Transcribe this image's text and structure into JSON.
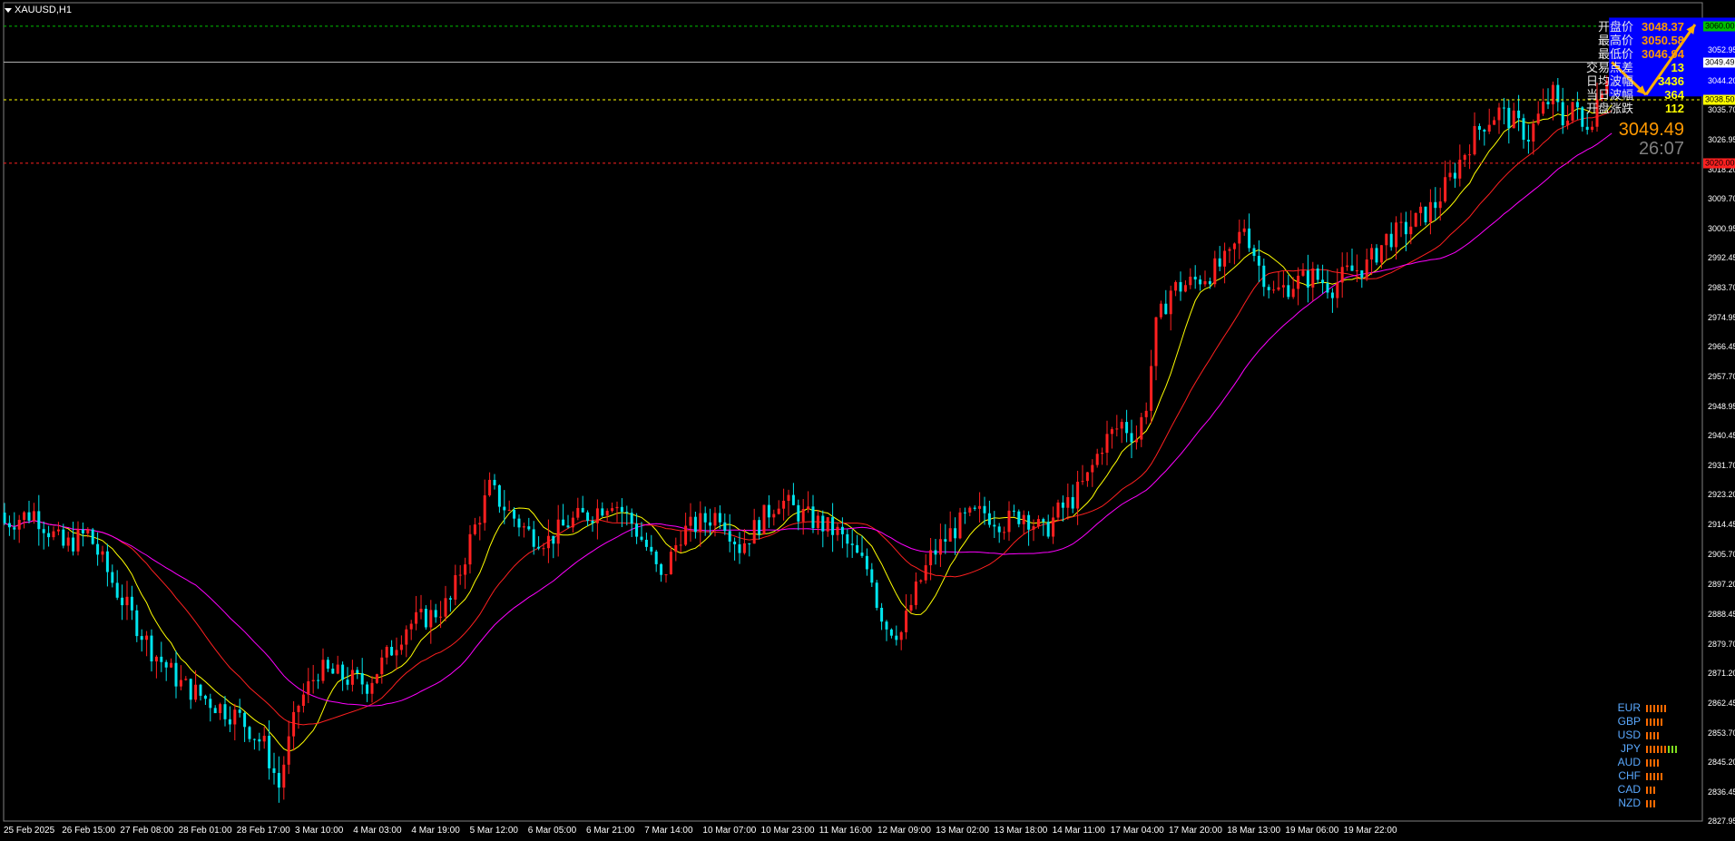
{
  "chart_title": "XAUUSD,H1",
  "chart_data": {
    "type": "candlestick",
    "symbol": "XAUUSD",
    "timeframe": "H1",
    "ylim": [
      2827.95,
      3065.0
    ],
    "price_ticks": [
      "3052.95",
      "3044.20",
      "3035.70",
      "3026.95",
      "3018.20",
      "3009.70",
      "3000.95",
      "2992.45",
      "2983.70",
      "2974.95",
      "2966.45",
      "2957.70",
      "2948.95",
      "2940.45",
      "2931.70",
      "2923.20",
      "2914.45",
      "2905.70",
      "2897.20",
      "2888.45",
      "2879.70",
      "2871.20",
      "2862.45",
      "2853.70",
      "2845.20",
      "2836.45",
      "2827.95"
    ],
    "time_labels": [
      "25 Feb 2025",
      "26 Feb 15:00",
      "27 Feb 08:00",
      "28 Feb 01:00",
      "28 Feb 17:00",
      "3 Mar 10:00",
      "4 Mar 03:00",
      "4 Mar 19:00",
      "5 Mar 12:00",
      "6 Mar 05:00",
      "6 Mar 21:00",
      "7 Mar 14:00",
      "10 Mar 07:00",
      "10 Mar 23:00",
      "11 Mar 16:00",
      "12 Mar 09:00",
      "13 Mar 02:00",
      "13 Mar 18:00",
      "14 Mar 11:00",
      "17 Mar 04:00",
      "17 Mar 20:00",
      "18 Mar 13:00",
      "19 Mar 06:00",
      "19 Mar 22:00"
    ],
    "horizontal_levels": [
      {
        "price": 3060.0,
        "label": "3060.00",
        "color": "#00c000"
      },
      {
        "price": 3049.49,
        "label": "3049.49",
        "color": "#b0b0b0"
      },
      {
        "price": 3038.5,
        "label": "3038.50",
        "color": "#ffff00"
      },
      {
        "price": 3020.0,
        "label": "3020.00",
        "color": "#ff2020"
      }
    ],
    "close_path": [
      [
        0,
        2915
      ],
      [
        6,
        2918
      ],
      [
        12,
        2908
      ],
      [
        17,
        2912
      ],
      [
        23,
        2895
      ],
      [
        30,
        2878
      ],
      [
        36,
        2868
      ],
      [
        43,
        2862
      ],
      [
        48,
        2858
      ],
      [
        53,
        2850
      ],
      [
        56,
        2838
      ],
      [
        57,
        2845
      ],
      [
        60,
        2862
      ],
      [
        64,
        2872
      ],
      [
        69,
        2870
      ],
      [
        74,
        2868
      ],
      [
        78,
        2876
      ],
      [
        82,
        2885
      ],
      [
        87,
        2888
      ],
      [
        91,
        2892
      ],
      [
        95,
        2910
      ],
      [
        99,
        2925
      ],
      [
        103,
        2918
      ],
      [
        107,
        2912
      ],
      [
        111,
        2910
      ],
      [
        115,
        2915
      ],
      [
        120,
        2918
      ],
      [
        124,
        2922
      ],
      [
        128,
        2915
      ],
      [
        131,
        2908
      ],
      [
        134,
        2898
      ],
      [
        138,
        2912
      ],
      [
        142,
        2915
      ],
      [
        146,
        2918
      ],
      [
        150,
        2908
      ],
      [
        154,
        2915
      ],
      [
        158,
        2922
      ],
      [
        162,
        2918
      ],
      [
        166,
        2915
      ],
      [
        170,
        2912
      ],
      [
        174,
        2905
      ],
      [
        177,
        2900
      ],
      [
        178,
        2892
      ],
      [
        180,
        2885
      ],
      [
        183,
        2883
      ],
      [
        186,
        2895
      ],
      [
        189,
        2905
      ],
      [
        193,
        2912
      ],
      [
        196,
        2916
      ],
      [
        200,
        2918
      ],
      [
        204,
        2915
      ],
      [
        208,
        2918
      ],
      [
        212,
        2912
      ],
      [
        215,
        2918
      ],
      [
        218,
        2922
      ],
      [
        221,
        2928
      ],
      [
        224,
        2938
      ],
      [
        228,
        2944
      ],
      [
        231,
        2940
      ],
      [
        233,
        2950
      ],
      [
        235,
        2972
      ],
      [
        238,
        2983
      ],
      [
        242,
        2985
      ],
      [
        246,
        2988
      ],
      [
        250,
        2992
      ],
      [
        253,
        3002
      ],
      [
        256,
        2990
      ],
      [
        259,
        2982
      ],
      [
        263,
        2985
      ],
      [
        267,
        2987
      ],
      [
        271,
        2984
      ],
      [
        274,
        2988
      ],
      [
        278,
        2990
      ],
      [
        282,
        2998
      ],
      [
        285,
        3000
      ],
      [
        288,
        3003
      ],
      [
        292,
        3008
      ],
      [
        296,
        3018
      ],
      [
        299,
        3026
      ],
      [
        302,
        3032
      ],
      [
        305,
        3035
      ],
      [
        308,
        3032
      ],
      [
        311,
        3028
      ],
      [
        314,
        3036
      ],
      [
        316,
        3040
      ],
      [
        318,
        3032
      ],
      [
        320,
        3038
      ],
      [
        322,
        3030
      ],
      [
        324,
        3034
      ],
      [
        326,
        3043
      ],
      [
        328,
        3049.49
      ]
    ],
    "series": [
      {
        "name": "",
        "color": "#ffff00"
      },
      {
        "name": "",
        "color": "#ff2020"
      },
      {
        "name": "",
        "color": "#ff00ff"
      }
    ],
    "forecast_box": {
      "price_top": 3062.5,
      "price_bottom": 3039.5,
      "color": "#0000ff"
    },
    "forecast_arrows": {
      "points": [
        [
          328,
          3049.5
        ],
        [
          335,
          3040.0
        ],
        [
          345,
          3060.5
        ]
      ],
      "color": "#ffb000"
    }
  },
  "info_panel": [
    {
      "label": "开盘价",
      "value": "3048.37",
      "color": "#ff9900"
    },
    {
      "label": "最高价",
      "value": "3050.58",
      "color": "#ff9900"
    },
    {
      "label": "最低价",
      "value": "3046.94",
      "color": "#ff9900"
    },
    {
      "label": "交易点差",
      "value": "13",
      "color": "#ffff00"
    },
    {
      "label": "日均波幅",
      "value": "3436",
      "color": "#ffff00"
    },
    {
      "label": "当日波幅",
      "value": "364",
      "color": "#ffff00"
    },
    {
      "label": "开盘涨跌",
      "value": "112",
      "color": "#ffff00"
    }
  ],
  "current_price": "3049.49",
  "countdown": "26:07",
  "currency_strength": [
    {
      "currency": "EUR",
      "red": 6,
      "green": 0
    },
    {
      "currency": "GBP",
      "red": 5,
      "green": 0
    },
    {
      "currency": "USD",
      "red": 4,
      "green": 0
    },
    {
      "currency": "JPY",
      "red": 6,
      "green": 3
    },
    {
      "currency": "AUD",
      "red": 4,
      "green": 0
    },
    {
      "currency": "CHF",
      "red": 5,
      "green": 0
    },
    {
      "currency": "CAD",
      "red": 3,
      "green": 0
    },
    {
      "currency": "NZD",
      "red": 3,
      "green": 0
    }
  ]
}
